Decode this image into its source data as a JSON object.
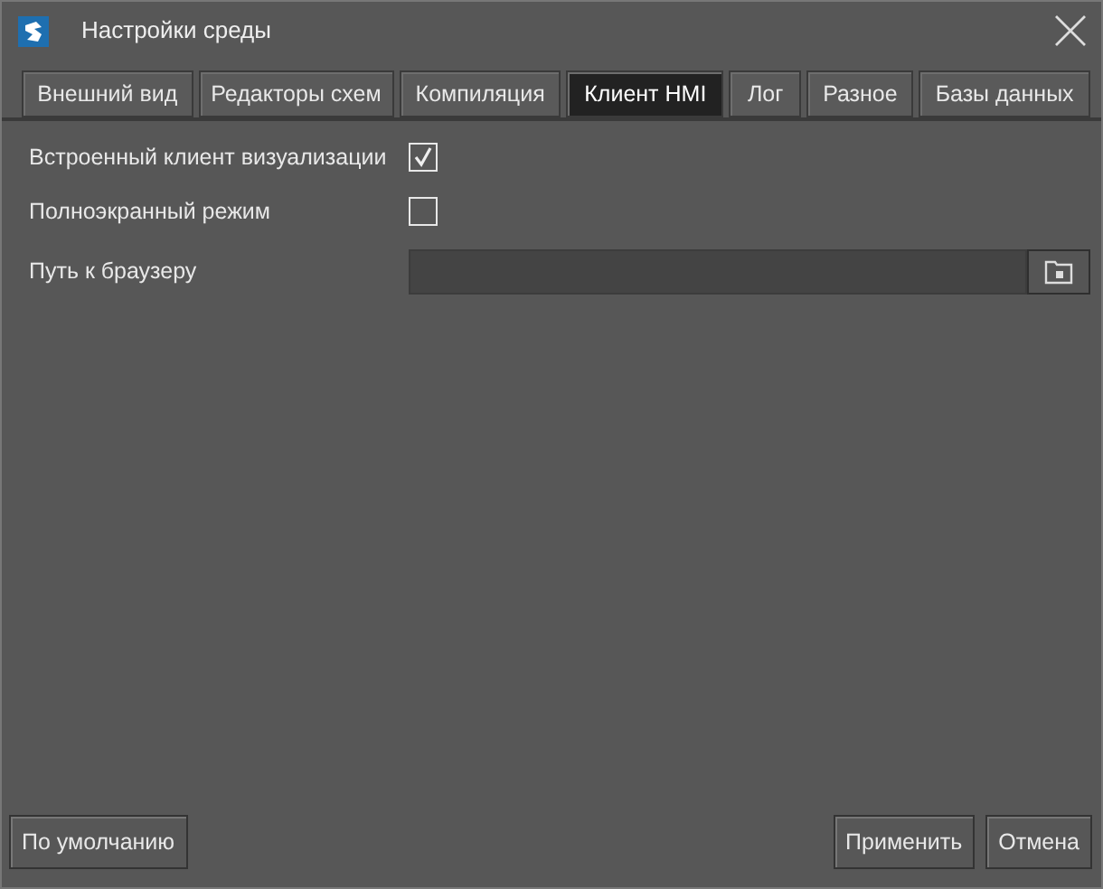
{
  "window": {
    "title": "Настройки среды"
  },
  "tabs": [
    {
      "label": "Внешний вид",
      "selected": false
    },
    {
      "label": "Редакторы схем",
      "selected": false
    },
    {
      "label": "Компиляция",
      "selected": false
    },
    {
      "label": "Клиент HMI",
      "selected": true
    },
    {
      "label": "Лог",
      "selected": false
    },
    {
      "label": "Разное",
      "selected": false
    },
    {
      "label": "Базы данных",
      "selected": false
    }
  ],
  "settings": [
    {
      "kind": "checkbox",
      "label": "Встроенный клиент визуализации",
      "checked": true
    },
    {
      "kind": "checkbox",
      "label": "Полноэкранный режим",
      "checked": false
    },
    {
      "kind": "path",
      "label": "Путь к браузеру"
    }
  ],
  "buttons_left": [
    "По умолчанию"
  ],
  "buttons_right": [
    "Применить",
    "Отмена"
  ]
}
